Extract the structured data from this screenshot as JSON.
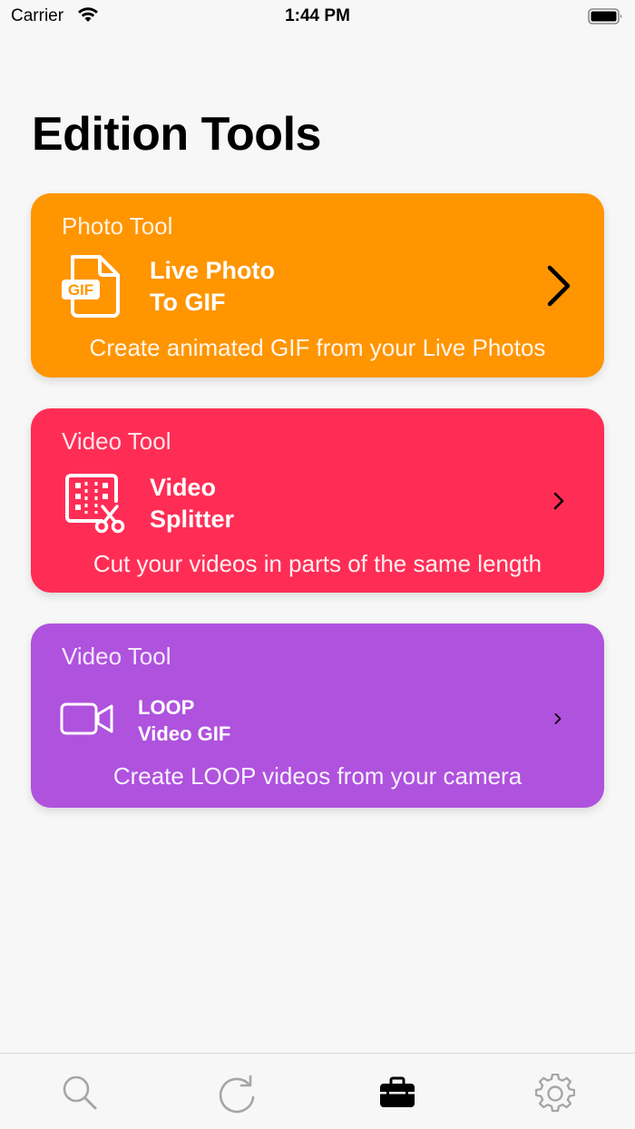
{
  "status_bar": {
    "carrier": "Carrier",
    "time": "1:44 PM"
  },
  "page": {
    "title": "Edition Tools"
  },
  "cards": [
    {
      "category": "Photo Tool",
      "title_line1": "Live Photo",
      "title_line2": "To GIF",
      "icon_label": "GIF",
      "description": "Create animated GIF from your Live Photos",
      "color": "#FF9500"
    },
    {
      "category": "Video Tool",
      "title_line1": "Video",
      "title_line2": "Splitter",
      "description": "Cut your videos in parts of the same length",
      "color": "#FF2D55"
    },
    {
      "category": "Video Tool",
      "title_line1": "LOOP",
      "title_line2": "Video GIF",
      "description": "Create LOOP videos from your camera",
      "color": "#AF52DE"
    }
  ],
  "tab_bar": {
    "tabs": [
      {
        "icon": "search-icon",
        "selected": false
      },
      {
        "icon": "refresh-icon",
        "selected": false
      },
      {
        "icon": "briefcase-icon",
        "selected": true
      },
      {
        "icon": "gear-icon",
        "selected": false
      }
    ],
    "active_color": "#000000",
    "inactive_color": "#A6A6A6"
  }
}
